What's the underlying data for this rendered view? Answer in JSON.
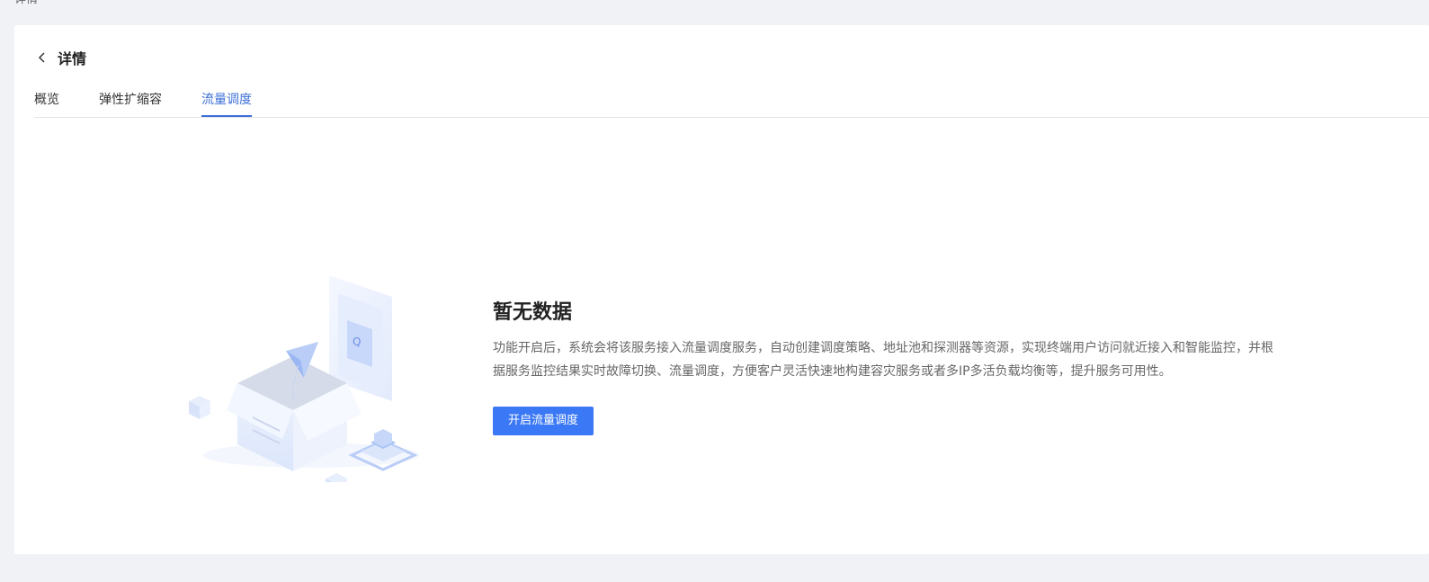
{
  "breadcrumb": {
    "text": "详情"
  },
  "header": {
    "title": "详情"
  },
  "tabs": [
    {
      "label": "概览",
      "active": false
    },
    {
      "label": "弹性扩缩容",
      "active": false
    },
    {
      "label": "流量调度",
      "active": true
    }
  ],
  "empty_state": {
    "title": "暂无数据",
    "description": "功能开启后，系统会将该服务接入流量调度服务，自动创建调度策略、地址池和探测器等资源，实现终端用户访问就近接入和智能监控，并根据服务监控结果实时故障切换、流量调度，方便客户灵活快速地构建容灾服务或者多IP多活负载均衡等，提升服务可用性。",
    "button_label": "开启流量调度"
  },
  "colors": {
    "accent": "#3b78f5",
    "tab_active": "#3b6fd8",
    "background": "#f0f2f5",
    "card": "#ffffff"
  }
}
